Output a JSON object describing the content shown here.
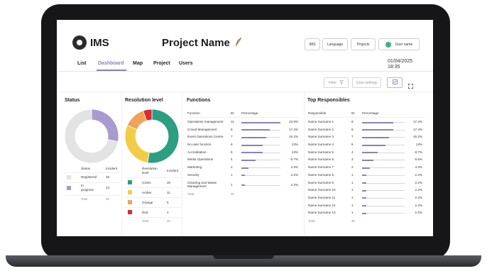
{
  "brand": {
    "name": "IMS",
    "logo_text": "RIGHT WHITE"
  },
  "project": {
    "title": "Project Name"
  },
  "header_buttons": {
    "ims": "IMS",
    "language": "Language",
    "projects": "Projects",
    "user": "User name"
  },
  "nav": {
    "items": [
      "List",
      "Dashboard",
      "Map",
      "Project",
      "Users"
    ],
    "active": "Dashboard"
  },
  "datetime": {
    "date": "01/04/2025",
    "time": "18:35"
  },
  "toolbar": {
    "filter": "Filter",
    "save": "Save settings"
  },
  "status": {
    "title": "Status",
    "headers": [
      "Status",
      "Incident"
    ],
    "rows": [
      {
        "label": "Registered",
        "value": "33",
        "color": "#e2e3e2"
      },
      {
        "label": "In progress",
        "value": "13",
        "color": "#a79bd0"
      }
    ],
    "total_label": "Total",
    "total_value": "46"
  },
  "resolution": {
    "title": "Resolution level",
    "headers": [
      "Resolution level",
      "Incident"
    ],
    "rows": [
      {
        "label": "Green",
        "value": "20",
        "color": "#2e9e83"
      },
      {
        "label": "Amber",
        "value": "11",
        "color": "#f2cc45"
      },
      {
        "label": "Orange",
        "value": "5",
        "color": "#f1a25a"
      },
      {
        "label": "Red",
        "value": "2",
        "color": "#e02a2a"
      }
    ],
    "total_label": "Total",
    "total_value": "46"
  },
  "functions": {
    "title": "Functions",
    "headers": [
      "Function",
      "ID",
      "Percentage"
    ],
    "rows": [
      {
        "name": "Operations management",
        "id": "11",
        "pct": "23.9%",
        "frac": 0.239
      },
      {
        "name": "Crowd Management",
        "id": "8",
        "pct": "17.4%",
        "frac": 0.174
      },
      {
        "name": "Event Operations Centre",
        "id": "7",
        "pct": "15.2%",
        "frac": 0.152
      },
      {
        "name": "No user function",
        "id": "6",
        "pct": "13%",
        "frac": 0.13
      },
      {
        "name": "Accreditation",
        "id": "6",
        "pct": "13%",
        "frac": 0.13
      },
      {
        "name": "Media Operations",
        "id": "4",
        "pct": "8.7%",
        "frac": 0.087
      },
      {
        "name": "Marketing",
        "id": "2",
        "pct": "4.3%",
        "frac": 0.043
      },
      {
        "name": "Security",
        "id": "1",
        "pct": "2.2%",
        "frac": 0.022
      },
      {
        "name": "Cleaning and Waste Management",
        "id": "1",
        "pct": "2.2%",
        "frac": 0.022
      }
    ],
    "total_label": "Total",
    "total_value": "46"
  },
  "responsibles": {
    "title": "Top Responsibles",
    "headers": [
      "Responsible",
      "ID",
      "Percentage"
    ],
    "rows": [
      {
        "name": "Name Surname 1",
        "id": "8",
        "pct": "17.4%",
        "frac": 0.174
      },
      {
        "name": "Name Surname 2",
        "id": "8",
        "pct": "17.4%",
        "frac": 0.174
      },
      {
        "name": "Name Surname 3",
        "id": "7",
        "pct": "15.2%",
        "frac": 0.152
      },
      {
        "name": "Name Surname 4",
        "id": "6",
        "pct": "13%",
        "frac": 0.13
      },
      {
        "name": "Name Surname 5",
        "id": "4",
        "pct": "8.7%",
        "frac": 0.087
      },
      {
        "name": "Name Surname 6",
        "id": "3",
        "pct": "6.5%",
        "frac": 0.065
      },
      {
        "name": "Name Surname 7",
        "id": "2",
        "pct": "4.3%",
        "frac": 0.043
      },
      {
        "name": "Name Surname 8",
        "id": "1",
        "pct": "2.2%",
        "frac": 0.022
      },
      {
        "name": "Name Surname 9",
        "id": "1",
        "pct": "2.2%",
        "frac": 0.022
      },
      {
        "name": "Name Surname 10",
        "id": "1",
        "pct": "2.2%",
        "frac": 0.022
      },
      {
        "name": "Name Surname 11",
        "id": "1",
        "pct": "2.2%",
        "frac": 0.022
      },
      {
        "name": "Name Surname 12",
        "id": "1",
        "pct": "2.2%",
        "frac": 0.022
      },
      {
        "name": "Name Surname 13",
        "id": "1",
        "pct": "2.2%",
        "frac": 0.022
      }
    ],
    "total_label": "Total",
    "total_value": "46"
  },
  "icons": {
    "logo": "eye-logo-icon",
    "feather": "feather-icon",
    "user": "user-status-icon",
    "filter": "filter-icon",
    "export": "export-icon",
    "fullscreen": "fullscreen-icon"
  }
}
